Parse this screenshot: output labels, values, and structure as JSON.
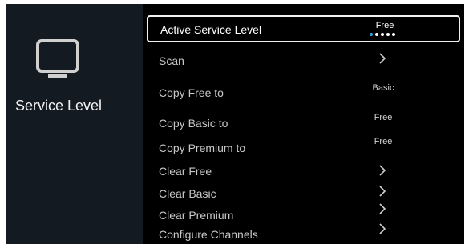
{
  "section": {
    "title": "Service Level",
    "icon": "tv-icon"
  },
  "menu": {
    "items": [
      {
        "label": "Active Service Level",
        "value": "Free",
        "selected": true
      },
      {
        "label": "Scan",
        "chevron": true
      },
      {
        "label": "Copy Free to",
        "value": "Basic"
      },
      {
        "label": "Copy Basic to",
        "value": "Free"
      },
      {
        "label": "Copy Premium to",
        "value": "Free"
      },
      {
        "label": "Clear Free",
        "chevron": true
      },
      {
        "label": "Clear Basic",
        "chevron": true
      },
      {
        "label": "Clear Premium",
        "chevron": true
      },
      {
        "label": "Configure Channels",
        "chevron": true
      }
    ],
    "level_indicator": {
      "count": 5,
      "active_index": 0
    }
  },
  "colors": {
    "background": "#000000",
    "side_panel": "#131a22",
    "accent": "#2fa3e0"
  }
}
